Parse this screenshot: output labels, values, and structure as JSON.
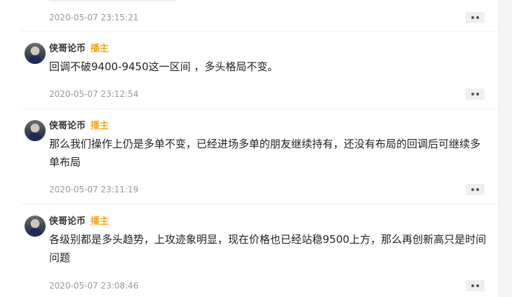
{
  "top_item": {
    "timestamp": "2020-05-07 23:15:21",
    "more_icon": "more-dots-icon"
  },
  "comments": [
    {
      "author": "侠哥论币",
      "role_badge": "播主",
      "text": "回调不破9400-9450这一区间 ，多头格局不变。",
      "timestamp": "2020-05-07 23:12:54"
    },
    {
      "author": "侠哥论币",
      "role_badge": "播主",
      "text": "那么我们操作上仍是多单不变，已经进场多单的朋友继续持有，还没有布局的回调后可继续多单布局",
      "timestamp": "2020-05-07 23:11:19"
    },
    {
      "author": "侠哥论币",
      "role_badge": "播主",
      "text": "各级别都是多头趋势，上攻迹象明显，现在价格也已经站稳9500上方，那么再创新高只是时间问题",
      "timestamp": "2020-05-07 23:08:46"
    }
  ],
  "colors": {
    "badge": "#f5a623",
    "timestamp": "#999999",
    "text": "#222222"
  }
}
